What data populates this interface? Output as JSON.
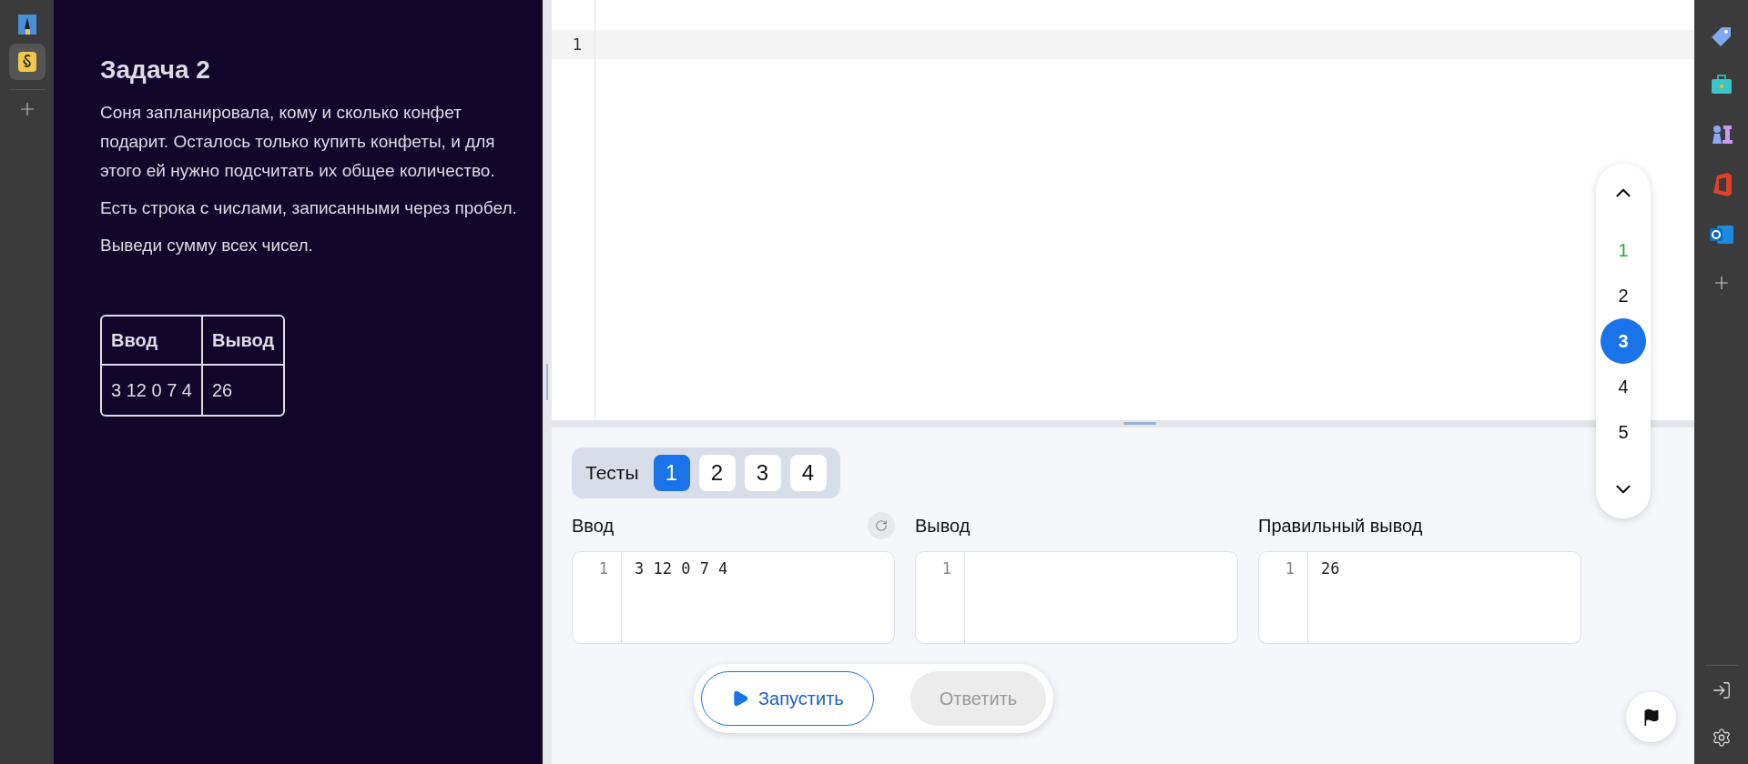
{
  "problem": {
    "title": "Задача 2",
    "paragraphs": [
      "Соня запланировала, кому и сколько конфет подарит. Осталось только купить конфеты, и для этого ей нужно подсчитать их общее количество.",
      "Есть строка с числами, записанными через пробел.",
      "Выведи сумму всех чисел."
    ],
    "example_table": {
      "columns": [
        "Ввод",
        "Вывод"
      ],
      "rows": [
        [
          "3 12 0 7 4",
          "26"
        ]
      ]
    }
  },
  "editor": {
    "line_numbers": [
      "1"
    ]
  },
  "task_nav": [
    {
      "label": "1",
      "selected": false,
      "solved": true
    },
    {
      "label": "2",
      "selected": false,
      "solved": false
    },
    {
      "label": "3",
      "selected": true,
      "solved": false
    },
    {
      "label": "4",
      "selected": false,
      "solved": false
    },
    {
      "label": "5",
      "selected": false,
      "solved": false
    }
  ],
  "tests": {
    "label": "Тесты",
    "items": [
      {
        "label": "1",
        "selected": true
      },
      {
        "label": "2",
        "selected": false
      },
      {
        "label": "3",
        "selected": false
      },
      {
        "label": "4",
        "selected": false
      }
    ]
  },
  "panels": [
    {
      "title": "Ввод",
      "reset": true,
      "line": "1",
      "value": "3 12 0 7 4"
    },
    {
      "title": "Вывод",
      "reset": false,
      "line": "1"
    },
    {
      "title": "Правильный вывод",
      "reset": false,
      "line": "1",
      "value": "26"
    }
  ],
  "actions": [
    {
      "label": "Запустить",
      "kind": "run",
      "disabled": false
    },
    {
      "label": "Ответить",
      "kind": "answer",
      "disabled": true
    }
  ]
}
